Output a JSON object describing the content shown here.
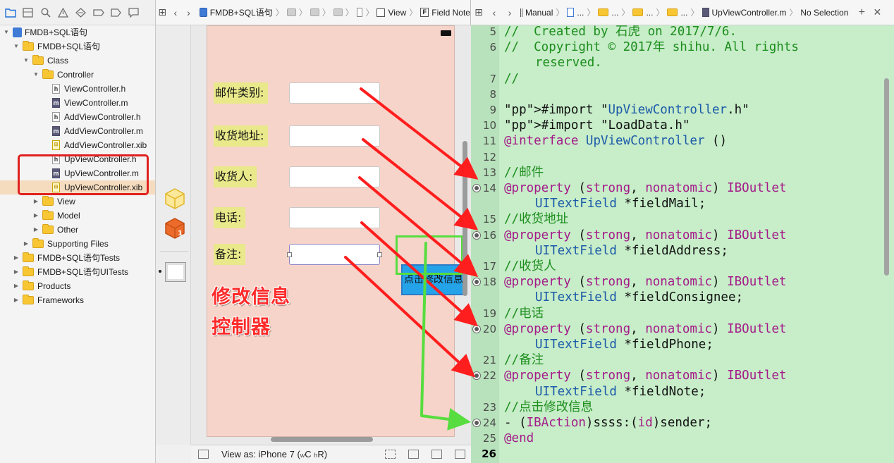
{
  "navigator": {
    "tree": [
      {
        "label": "FMDB+SQL语句",
        "type": "project",
        "depth": 0,
        "expanded": true
      },
      {
        "label": "FMDB+SQL语句",
        "type": "folder",
        "depth": 1,
        "expanded": true
      },
      {
        "label": "Class",
        "type": "folder",
        "depth": 2,
        "expanded": true
      },
      {
        "label": "Controller",
        "type": "folder",
        "depth": 3,
        "expanded": true
      },
      {
        "label": "ViewController.h",
        "type": "h",
        "depth": 4
      },
      {
        "label": "ViewController.m",
        "type": "m",
        "depth": 4
      },
      {
        "label": "AddViewController.h",
        "type": "h",
        "depth": 4
      },
      {
        "label": "AddViewController.m",
        "type": "m",
        "depth": 4
      },
      {
        "label": "AddViewController.xib",
        "type": "xib",
        "depth": 4
      },
      {
        "label": "UpViewController.h",
        "type": "h",
        "depth": 4
      },
      {
        "label": "UpViewController.m",
        "type": "m",
        "depth": 4
      },
      {
        "label": "UpViewController.xib",
        "type": "xib",
        "depth": 4,
        "selected": true
      },
      {
        "label": "View",
        "type": "folder",
        "depth": 3,
        "expanded": false
      },
      {
        "label": "Model",
        "type": "folder",
        "depth": 3,
        "expanded": false
      },
      {
        "label": "Other",
        "type": "folder",
        "depth": 3,
        "expanded": false
      },
      {
        "label": "Supporting Files",
        "type": "folder",
        "depth": 2,
        "expanded": false
      },
      {
        "label": "FMDB+SQL语句Tests",
        "type": "folder",
        "depth": 1,
        "expanded": false
      },
      {
        "label": "FMDB+SQL语句UITests",
        "type": "folder",
        "depth": 1,
        "expanded": false
      },
      {
        "label": "Products",
        "type": "folder",
        "depth": 1,
        "expanded": false
      },
      {
        "label": "Frameworks",
        "type": "folder",
        "depth": 1,
        "expanded": false
      }
    ]
  },
  "ib": {
    "jumpbar": {
      "project": "FMDB+SQL语句",
      "view": "View",
      "field": "Field Note"
    },
    "form": {
      "labels": [
        "邮件类别:",
        "收货地址:",
        "收货人:",
        "电话:",
        "备注:"
      ],
      "button_label": "点击修改信息"
    },
    "caption": [
      "修改信息",
      "控制器"
    ],
    "bottom": {
      "view_as": "View as: iPhone 7 (",
      "w": "w",
      "c": "C",
      "h": "h",
      "r": "R)"
    }
  },
  "editor": {
    "jumpbar": {
      "manual": "Manual",
      "ellipsis": "...",
      "file": "UpViewController.m",
      "selection": "No Selection"
    },
    "lines": [
      {
        "n": "5",
        "text": "//  Created by 石虎 on 2017/7/6."
      },
      {
        "n": "6",
        "text": "//  Copyright © 2017年 shihu. All rights"
      },
      {
        "n": "",
        "text": "reserved."
      },
      {
        "n": "7",
        "text": "//"
      },
      {
        "n": "8",
        "text": ""
      },
      {
        "n": "9",
        "text": "#import \"UpViewController.h\""
      },
      {
        "n": "10",
        "text": "#import \"LoadData.h\""
      },
      {
        "n": "11",
        "text": "@interface UpViewController ()"
      },
      {
        "n": "12",
        "text": ""
      },
      {
        "n": "13",
        "text": "//邮件"
      },
      {
        "n": "14",
        "text": "@property (strong, nonatomic) IBOutlet"
      },
      {
        "n": "",
        "text": "UITextField *fieldMail;"
      },
      {
        "n": "15",
        "text": "//收货地址"
      },
      {
        "n": "16",
        "text": "@property (strong, nonatomic) IBOutlet"
      },
      {
        "n": "",
        "text": "UITextField *fieldAddress;"
      },
      {
        "n": "17",
        "text": "//收货人"
      },
      {
        "n": "18",
        "text": "@property (strong, nonatomic) IBOutlet"
      },
      {
        "n": "",
        "text": "UITextField *fieldConsignee;"
      },
      {
        "n": "19",
        "text": "//电话"
      },
      {
        "n": "20",
        "text": "@property (strong, nonatomic) IBOutlet"
      },
      {
        "n": "",
        "text": "UITextField *fieldPhone;"
      },
      {
        "n": "21",
        "text": "//备注"
      },
      {
        "n": "22",
        "text": "@property (strong, nonatomic) IBOutlet"
      },
      {
        "n": "",
        "text": "UITextField *fieldNote;"
      },
      {
        "n": "23",
        "text": "//点击修改信息"
      },
      {
        "n": "24",
        "text": "- (IBAction)ssss:(id)sender;"
      },
      {
        "n": "25",
        "text": "@end"
      },
      {
        "n": "26",
        "text": ""
      }
    ]
  },
  "colors": {
    "annotation_red": "#e0201f",
    "annotation_green": "#57dd3f",
    "editor_bg": "#c7edc9",
    "current_line": "#5ee84b",
    "canvas_view": "#f6d4c9",
    "label_bg": "#e9e98b",
    "button_blue": "#25a3e8"
  }
}
